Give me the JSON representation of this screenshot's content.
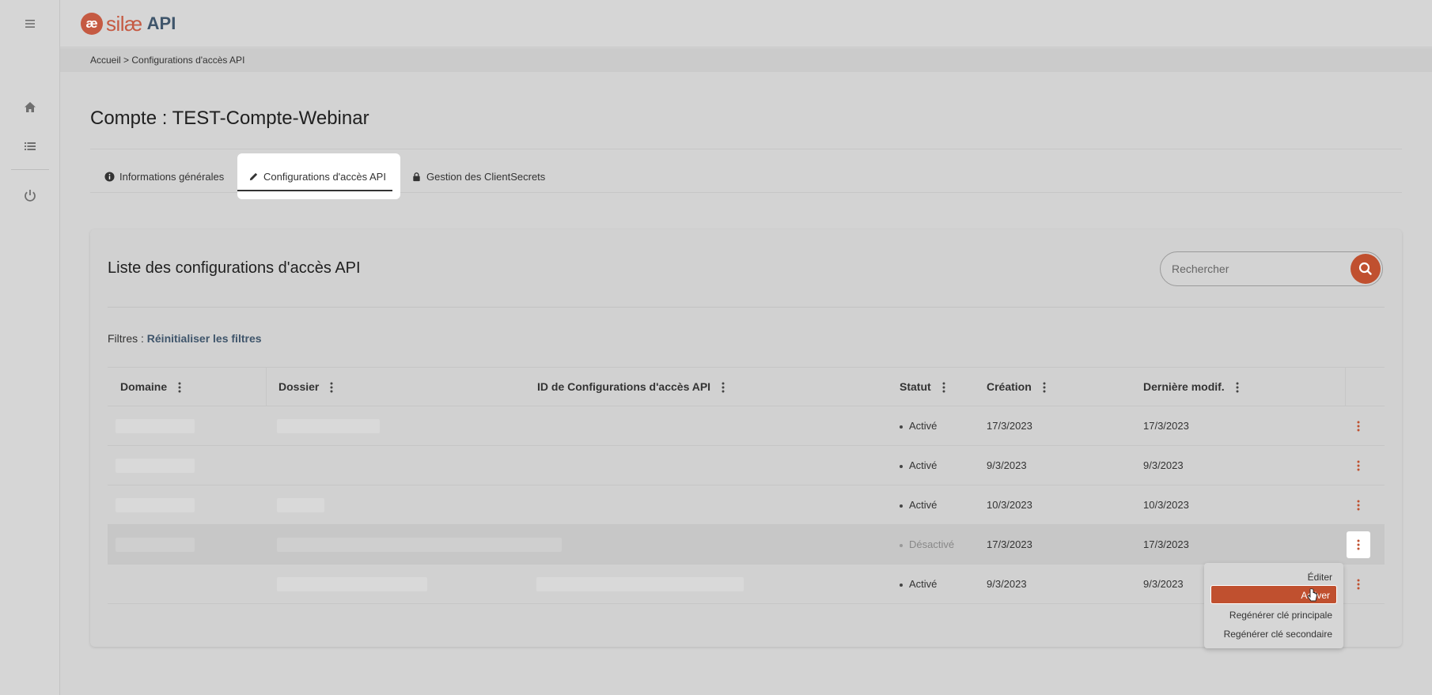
{
  "app": {
    "logo_mark": "æ",
    "brand": "silæ",
    "product": "API"
  },
  "breadcrumb": "Accueil > Configurations d'accès API",
  "page": {
    "title": "Compte : TEST-Compte-Webinar"
  },
  "tabs": [
    {
      "label": "Informations générales",
      "icon": "info-icon"
    },
    {
      "label": "Configurations d'accès API",
      "icon": "pencil-icon"
    },
    {
      "label": "Gestion des ClientSecrets",
      "icon": "lock-icon"
    }
  ],
  "card": {
    "title": "Liste des configurations d'accès API",
    "search_placeholder": "Rechercher",
    "filters_label": "Filtres :",
    "filters_reset": "Réinitialiser les filtres"
  },
  "table": {
    "columns": [
      "Domaine",
      "Dossier",
      "ID de Configurations d'accès API",
      "Statut",
      "Création",
      "Dernière modif."
    ],
    "rows": [
      {
        "status": "Activé",
        "created": "17/3/2023",
        "modified": "17/3/2023"
      },
      {
        "status": "Activé",
        "created": "9/3/2023",
        "modified": "9/3/2023"
      },
      {
        "status": "Activé",
        "created": "10/3/2023",
        "modified": "10/3/2023"
      },
      {
        "status": "Désactivé",
        "created": "17/3/2023",
        "modified": "17/3/2023"
      },
      {
        "status": "Activé",
        "created": "9/3/2023",
        "modified": "9/3/2023"
      }
    ]
  },
  "dropdown": {
    "items": [
      "Éditer",
      "Activer",
      "Regénérer clé principale",
      "Regénérer clé secondaire"
    ]
  },
  "colors": {
    "accent": "#c0502f",
    "brand": "#c55a42",
    "link": "#3f556b"
  }
}
